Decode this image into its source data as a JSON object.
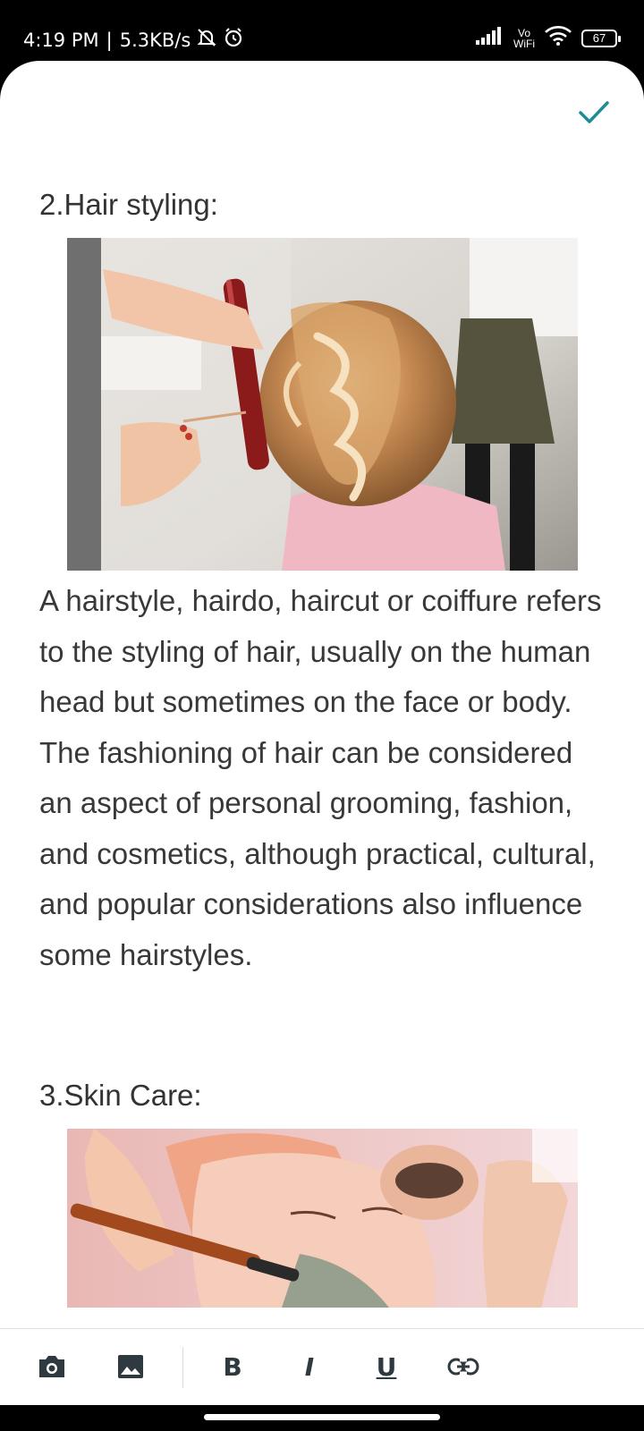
{
  "status_bar": {
    "time": "4:19 PM",
    "separator": "|",
    "network_speed": "5.3KB/s",
    "vowifi_top": "Vo",
    "vowifi_bottom": "WiFi",
    "battery": "67"
  },
  "editor": {
    "sections": [
      {
        "title": "2.Hair styling:",
        "image_alt": "Hairdresser styling a braided updo with a curling iron",
        "paragraph": "A hairstyle, hairdo, haircut or coiffure refers to the styling of hair, usually on the human head but sometimes on the face or body. The fashioning of hair can be considered an aspect of personal grooming, fashion, and cosmetics, although practical, cultural, and popular considerations also influence some hairstyles."
      },
      {
        "title": "3.Skin Care:",
        "image_alt": "Woman receiving a facial mask treatment applied with a brush"
      }
    ]
  },
  "toolbar": {
    "bold": "B",
    "italic": "I",
    "underline": "U"
  },
  "colors": {
    "accent": "#1e8c96",
    "text": "#383838",
    "icon": "#2f3a40"
  }
}
